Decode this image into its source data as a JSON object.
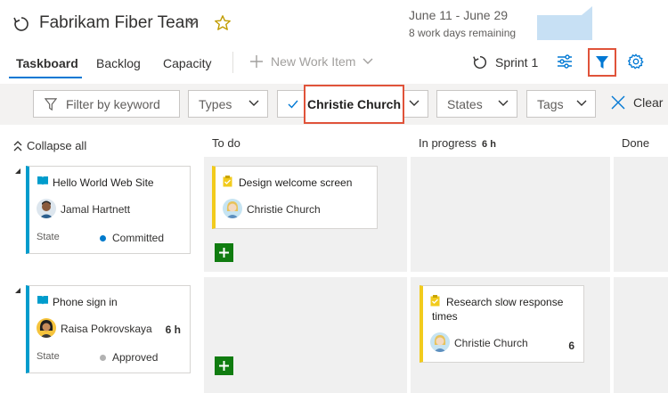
{
  "header": {
    "team_name": "Fabrikam Fiber Team",
    "date_range": "June 11 - June 29",
    "days_remaining": "8 work days remaining",
    "burndown_color": "#c7e0f4"
  },
  "nav": {
    "tabs": [
      {
        "label": "Taskboard",
        "active": true
      },
      {
        "label": "Backlog",
        "active": false
      },
      {
        "label": "Capacity",
        "active": false
      }
    ],
    "new_work_item": "New Work Item",
    "sprint": "Sprint 1"
  },
  "filters": {
    "keyword_placeholder": "Filter by keyword",
    "types": "Types",
    "people_selected": "Christie Church",
    "states": "States",
    "tags": "Tags",
    "clear": "Clear"
  },
  "board": {
    "collapse_all": "Collapse all",
    "columns": [
      {
        "name": "To do",
        "hours": ""
      },
      {
        "name": "In progress",
        "hours": "6 h"
      },
      {
        "name": "Done",
        "hours": ""
      }
    ],
    "rows": [
      {
        "story": {
          "title": "Hello World Web Site",
          "assignee": "Jamal Hartnett",
          "hours": "",
          "state_label": "State",
          "state": "Committed",
          "state_color": "#007acc"
        },
        "todo": [
          {
            "title": "Design welcome screen",
            "assignee": "Christie Church",
            "hours": ""
          }
        ],
        "in_progress": []
      },
      {
        "story": {
          "title": "Phone sign in",
          "assignee": "Raisa Pokrovskaya",
          "hours": "6 h",
          "state_label": "State",
          "state": "Approved",
          "state_color": "#b2b2b2"
        },
        "todo": [],
        "in_progress": [
          {
            "title": "Research slow response times",
            "assignee": "Christie Church",
            "hours": "6"
          }
        ]
      }
    ]
  },
  "colors": {
    "accent": "#0078d4",
    "highlight_border": "#e0533a",
    "story_bar": "#009ccc",
    "task_bar": "#f2cb1d",
    "add_button": "#107c10"
  },
  "icons": {
    "team": "sprint-cycle-icon",
    "favorite": "star-icon",
    "filter": "funnel-icon",
    "settings": "gear-icon",
    "view_options": "sliders-icon",
    "story": "book-icon",
    "task": "clipboard-icon"
  }
}
